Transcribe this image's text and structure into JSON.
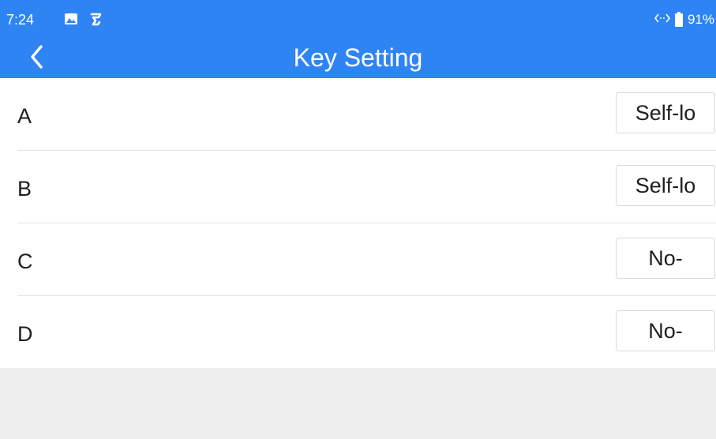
{
  "status_bar": {
    "time": "7:24",
    "battery": "91%",
    "icons": [
      "image-icon",
      "app-s-icon",
      "data-transfer-icon",
      "battery-icon"
    ]
  },
  "header": {
    "title": "Key Setting",
    "back_icon": "chevron-left-icon"
  },
  "keys": [
    {
      "label": "A",
      "value": "Self-lo"
    },
    {
      "label": "B",
      "value": "Self-lo"
    },
    {
      "label": "C",
      "value": "No-"
    },
    {
      "label": "D",
      "value": "No-"
    }
  ],
  "colors": {
    "header_bg": "#2f84f4",
    "footer_bg": "#eeeeee"
  }
}
